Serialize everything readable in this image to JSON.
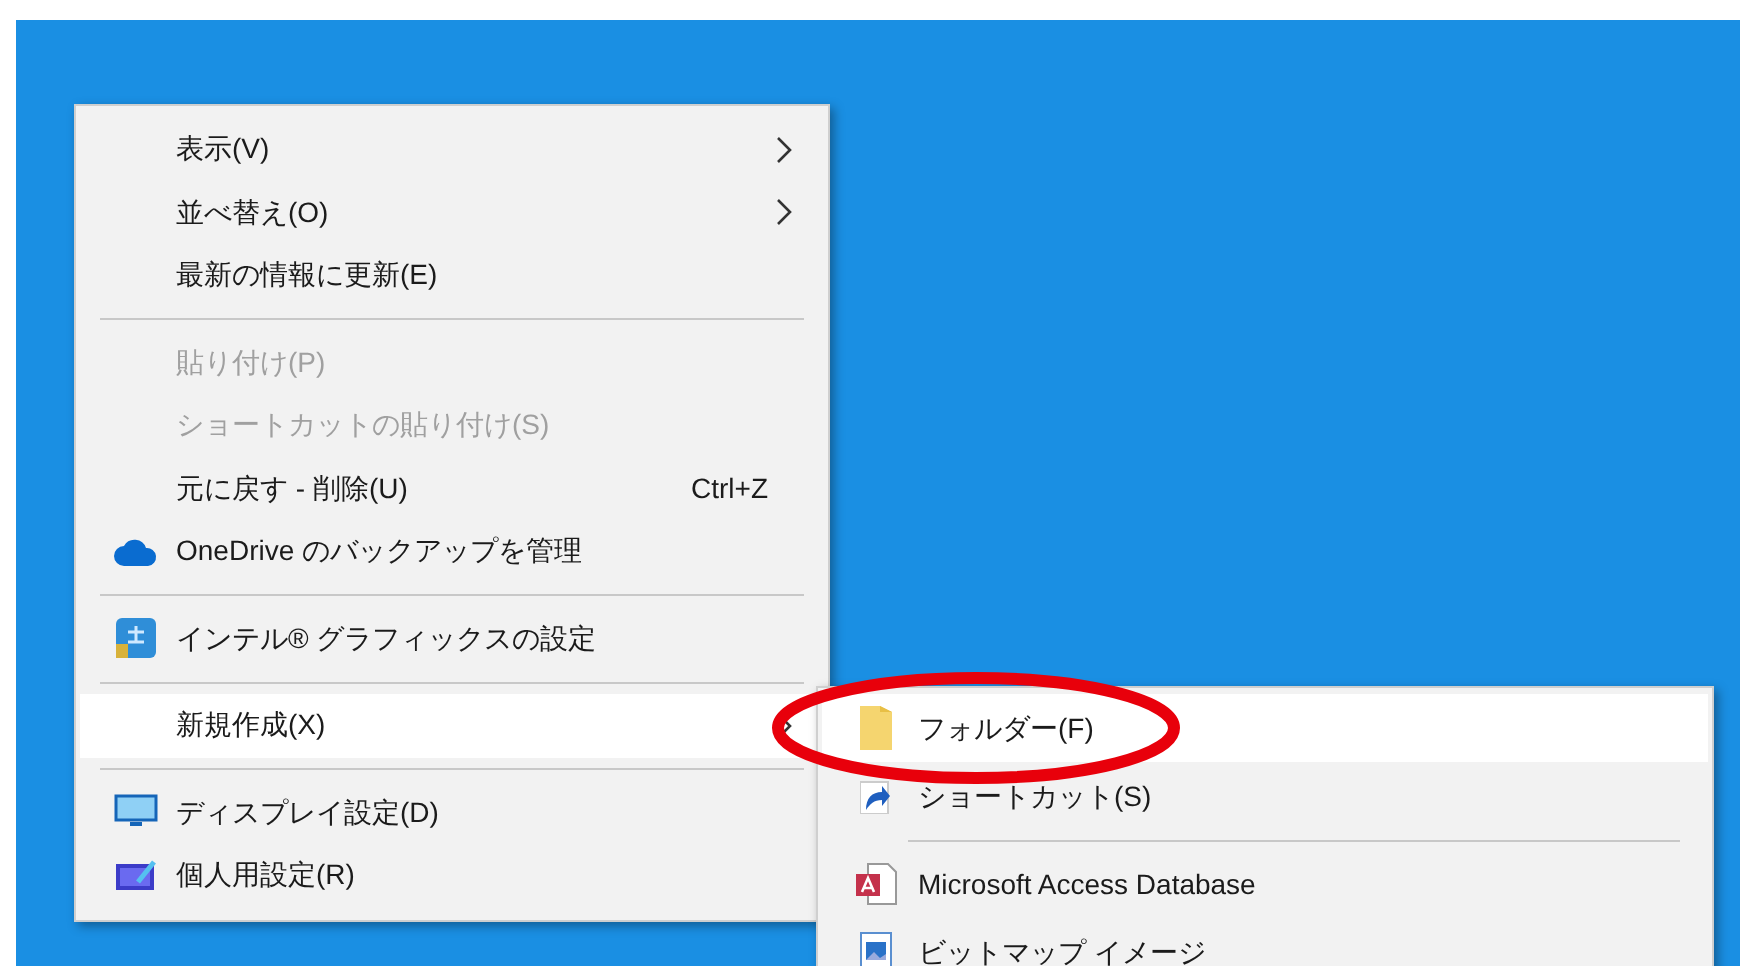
{
  "context_menu": {
    "items": [
      {
        "kind": "item",
        "label": "表示(V)",
        "submenu": true,
        "disabled": false,
        "selected": false
      },
      {
        "kind": "item",
        "label": "並べ替え(O)",
        "submenu": true,
        "disabled": false,
        "selected": false
      },
      {
        "kind": "item",
        "label": "最新の情報に更新(E)",
        "submenu": false,
        "disabled": false,
        "selected": false
      },
      {
        "kind": "separator"
      },
      {
        "kind": "item",
        "label": "貼り付け(P)",
        "submenu": false,
        "disabled": true,
        "selected": false
      },
      {
        "kind": "item",
        "label": "ショートカットの貼り付け(S)",
        "submenu": false,
        "disabled": true,
        "selected": false
      },
      {
        "kind": "item",
        "label": "元に戻す - 削除(U)",
        "shortcut": "Ctrl+Z",
        "submenu": false,
        "disabled": false,
        "selected": false
      },
      {
        "kind": "item",
        "label": "OneDrive のバックアップを管理",
        "submenu": false,
        "disabled": false,
        "selected": false
      },
      {
        "kind": "separator"
      },
      {
        "kind": "item",
        "label": "インテル® グラフィックスの設定",
        "submenu": false,
        "disabled": false,
        "selected": false
      },
      {
        "kind": "separator"
      },
      {
        "kind": "item",
        "label": "新規作成(X)",
        "submenu": true,
        "disabled": false,
        "selected": true
      },
      {
        "kind": "separator"
      },
      {
        "kind": "item",
        "label": "ディスプレイ設定(D)",
        "submenu": false,
        "disabled": false,
        "selected": false
      },
      {
        "kind": "item",
        "label": "個人用設定(R)",
        "submenu": false,
        "disabled": false,
        "selected": false
      }
    ]
  },
  "new_submenu": {
    "items": [
      {
        "kind": "item",
        "label": "フォルダー(F)",
        "selected": true
      },
      {
        "kind": "item",
        "label": "ショートカット(S)",
        "selected": false
      },
      {
        "kind": "separator"
      },
      {
        "kind": "item",
        "label": "Microsoft Access Database",
        "selected": false
      },
      {
        "kind": "item",
        "label": "ビットマップ イメージ",
        "selected": false
      }
    ]
  },
  "annotation": {
    "kind": "ellipse",
    "color": "#e8000b"
  }
}
